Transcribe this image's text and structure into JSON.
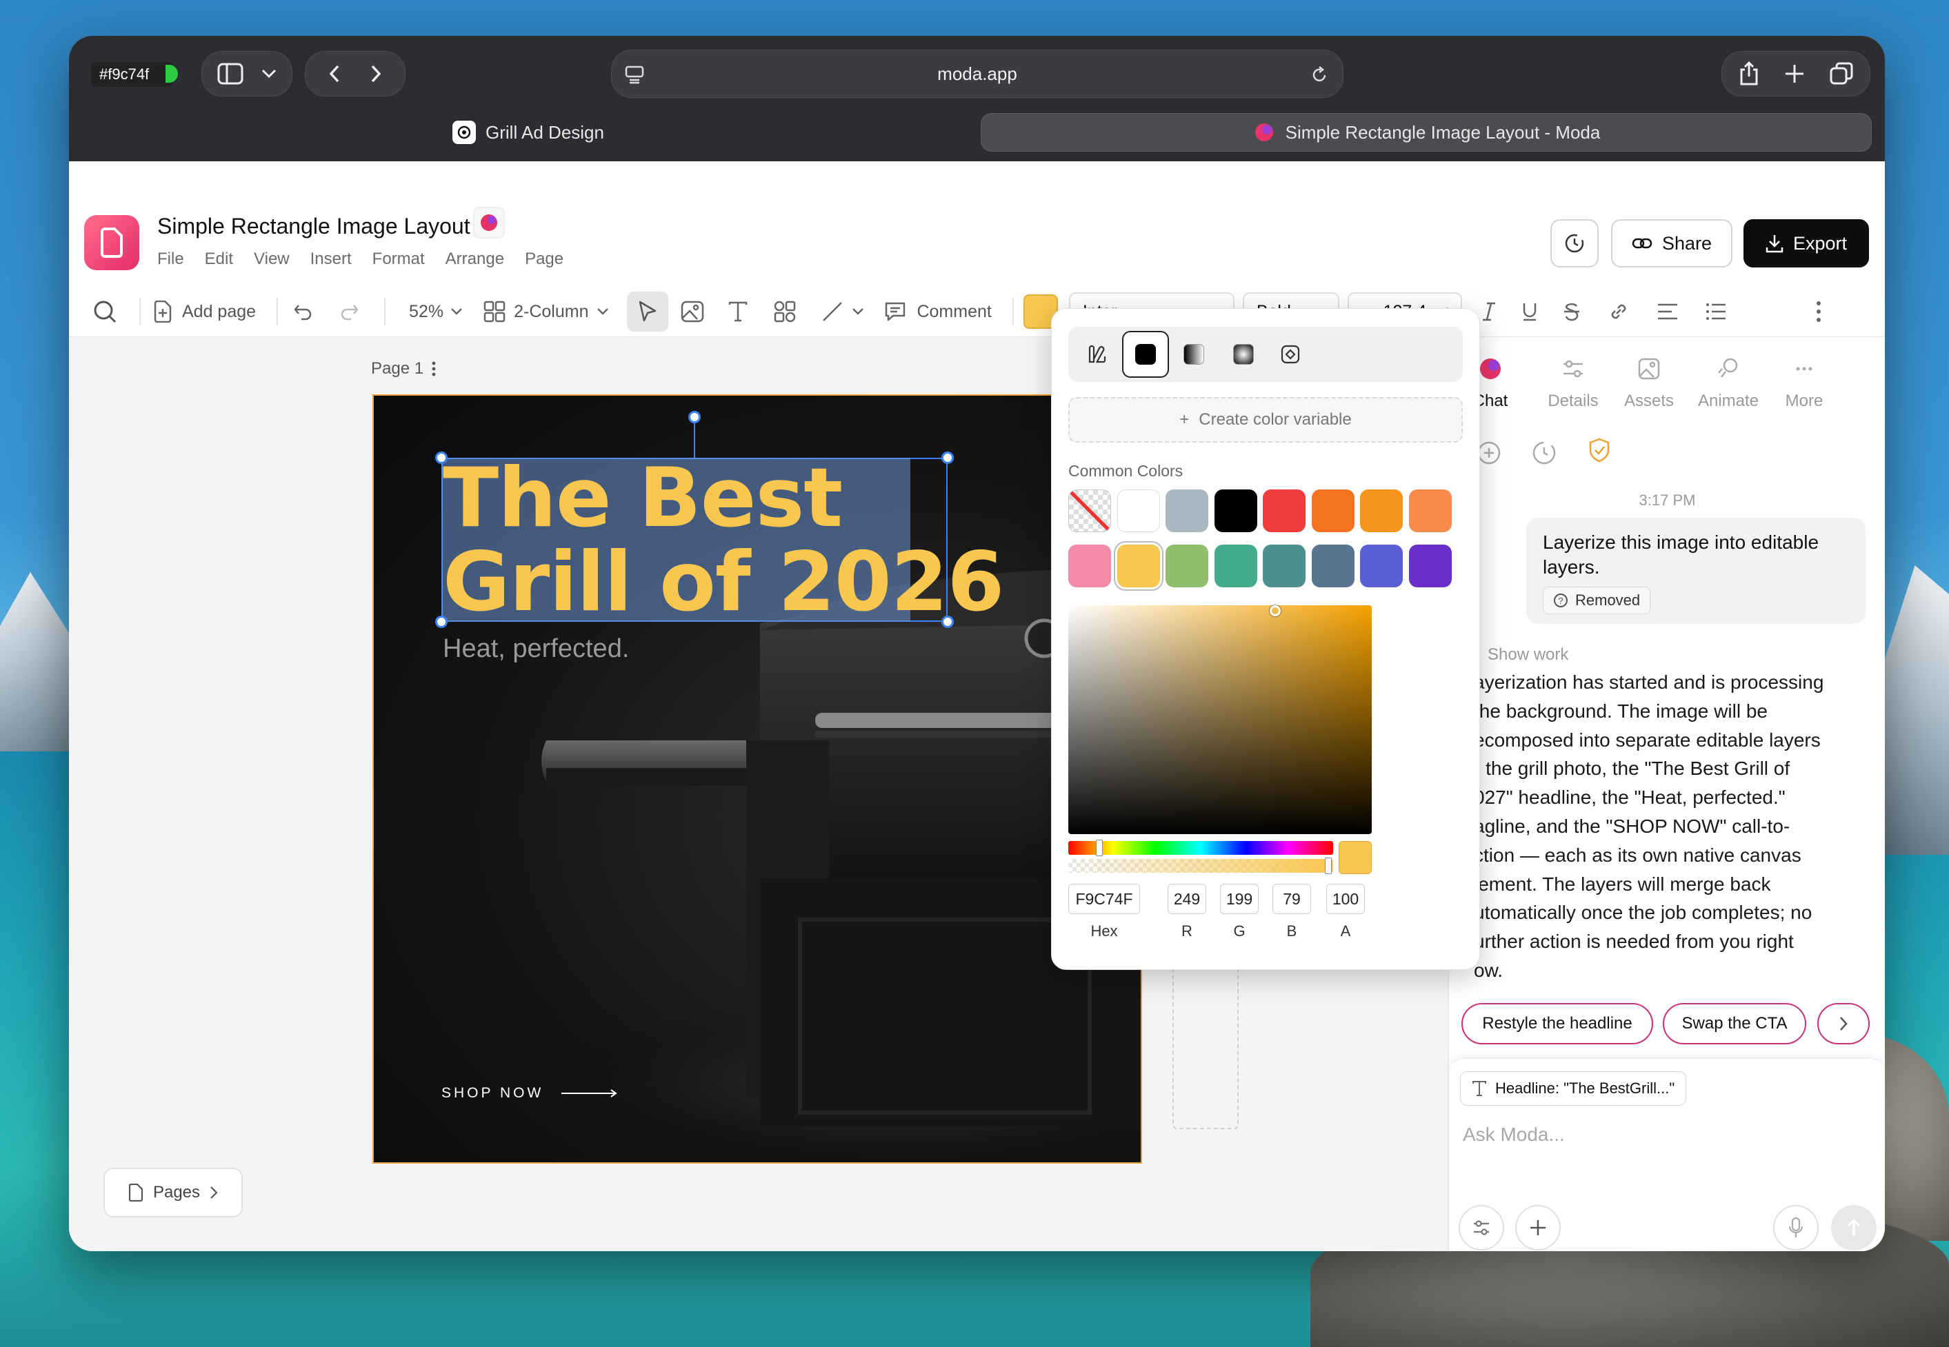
{
  "desktop": {
    "color_tooltip": "#f9c74f"
  },
  "browser": {
    "url": "moda.app",
    "tabs": [
      {
        "label": "Grill Ad Design"
      },
      {
        "label": "Simple Rectangle Image Layout - Moda"
      }
    ]
  },
  "app": {
    "doc_title": "Simple Rectangle Image Layout",
    "menu": [
      "File",
      "Edit",
      "View",
      "Insert",
      "Format",
      "Arrange",
      "Page"
    ],
    "share_label": "Share",
    "export_label": "Export"
  },
  "toolbar": {
    "add_page": "Add page",
    "zoom": "52%",
    "layout": "2-Column",
    "comment": "Comment",
    "font": "Inter",
    "weight": "Bold",
    "size": "127.4",
    "fill_color": "#f9c74f"
  },
  "canvas": {
    "page_label": "Page 1",
    "headline_line1": "The Best",
    "headline_line2": "Grill of 2026",
    "tagline": "Heat, perfected.",
    "cta": "SHOP NOW",
    "pages_button": "Pages"
  },
  "color_picker": {
    "create_variable": "Create color variable",
    "common_colors_label": "Common Colors",
    "swatches": [
      "none",
      "#ffffff",
      "#a9b7c1",
      "#000000",
      "#f03c3c",
      "#f37321",
      "#f7941d",
      "#f88a4b",
      "#f38ba8",
      "#f9c74f",
      "#90be6d",
      "#43aa8b",
      "#4d908e",
      "#577590",
      "#5b5fd6",
      "#6a2fc8"
    ],
    "hex": "F9C74F",
    "r": "249",
    "g": "199",
    "b": "79",
    "a": "100",
    "labels": {
      "hex": "Hex",
      "r": "R",
      "g": "G",
      "b": "B",
      "a": "A"
    }
  },
  "panel": {
    "tabs": [
      "Chat",
      "Details",
      "Assets",
      "Animate",
      "More"
    ],
    "time": "3:17 PM",
    "user_message": "Layerize this image into editable layers.",
    "removed_label": "Removed",
    "show_work": "Show work",
    "assistant_lines": [
      "ayerization has started and is processing",
      " the background. The image will be",
      "ecomposed into separate editable layers",
      "- the grill photo, the \"The Best Grill of",
      "027\" headline, the \"Heat, perfected.\"",
      "agline, and the \"SHOP NOW\" call-to-",
      "ction — each as its own native canvas",
      "lement. The layers will merge back",
      "utomatically once the job completes; no",
      "urther action is needed from you right",
      "ow."
    ],
    "suggestions": [
      "Restyle the headline",
      "Swap the CTA"
    ],
    "context_chip": "Headline: \"The BestGrill...\"",
    "input_placeholder": "Ask Moda..."
  }
}
